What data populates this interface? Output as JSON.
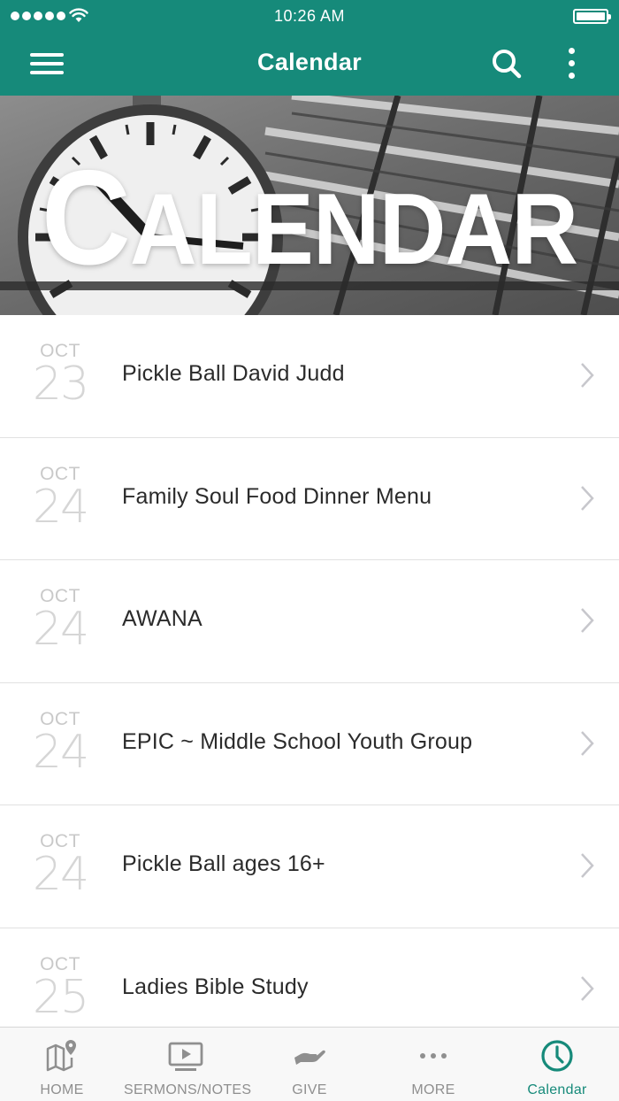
{
  "status_bar": {
    "time": "10:26 AM"
  },
  "nav": {
    "title": "Calendar"
  },
  "banner": {
    "first_letter": "C",
    "rest": "ALENDAR"
  },
  "events": [
    {
      "month": "OCT",
      "day": "23",
      "title": "Pickle Ball David Judd"
    },
    {
      "month": "OCT",
      "day": "24",
      "title": "Family Soul Food Dinner Menu"
    },
    {
      "month": "OCT",
      "day": "24",
      "title": "AWANA"
    },
    {
      "month": "OCT",
      "day": "24",
      "title": "EPIC ~ Middle School Youth Group"
    },
    {
      "month": "OCT",
      "day": "24",
      "title": "Pickle Ball ages 16+"
    },
    {
      "month": "OCT",
      "day": "25",
      "title": "Ladies Bible Study"
    }
  ],
  "tabs": [
    {
      "label": "HOME",
      "icon": "map-pin-icon"
    },
    {
      "label": "SERMONS/NOTES",
      "icon": "video-play-icon"
    },
    {
      "label": "GIVE",
      "icon": "giving-hand-icon"
    },
    {
      "label": "MORE",
      "icon": "more-dots-icon"
    },
    {
      "label": "Calendar",
      "icon": "clock-icon",
      "active": true
    }
  ],
  "colors": {
    "primary": "#168a7a",
    "tab_inactive": "#8f8f8f",
    "date_text": "#c9c9c9"
  }
}
